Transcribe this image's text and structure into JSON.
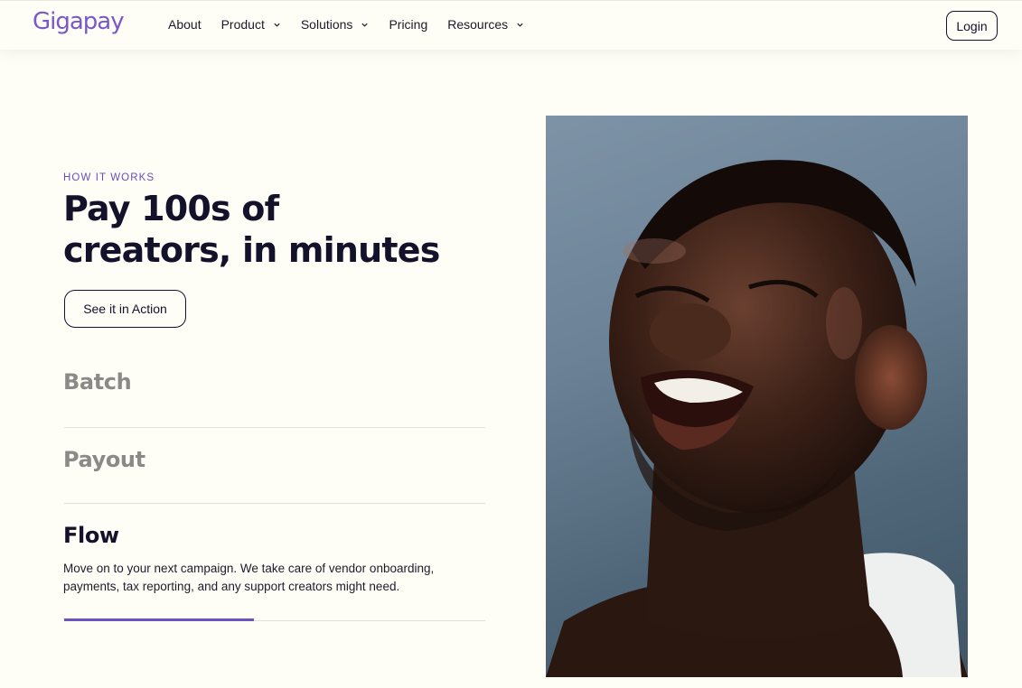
{
  "brand": {
    "logo_text": "Gigapay",
    "accent": "#6e52c0"
  },
  "nav": {
    "items": [
      {
        "label": "About",
        "has_dropdown": false
      },
      {
        "label": "Product",
        "has_dropdown": true
      },
      {
        "label": "Solutions",
        "has_dropdown": true
      },
      {
        "label": "Pricing",
        "has_dropdown": false
      },
      {
        "label": "Resources",
        "has_dropdown": true
      }
    ],
    "login_label": "Login"
  },
  "hero": {
    "eyebrow": "HOW IT WORKS",
    "headline_line1": "Pay 100s of",
    "headline_line2": "creators, in minutes",
    "cta_label": "See it in Action"
  },
  "steps": [
    {
      "label": "Batch",
      "active": false
    },
    {
      "label": "Payout",
      "active": false
    },
    {
      "label": "Flow",
      "active": true
    }
  ],
  "active_step": {
    "description": "Move on to your next campaign. We take care of vendor onboarding, payments, tax reporting, and any support creators might need.",
    "progress_fraction": 0.45
  },
  "photo": {
    "subject": "portrait-photo"
  }
}
